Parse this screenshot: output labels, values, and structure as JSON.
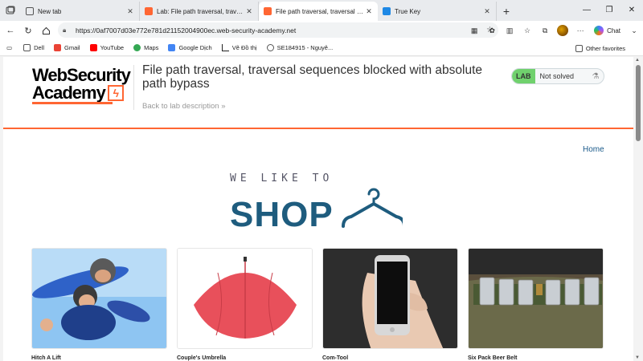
{
  "browser": {
    "tabs": [
      {
        "title": "New tab",
        "active": false
      },
      {
        "title": "Lab: File path traversal, traversal se",
        "active": false
      },
      {
        "title": "File path traversal, traversal seque",
        "active": true
      },
      {
        "title": "True Key",
        "active": false
      }
    ],
    "url": "https://0af7007d03e772e781d21152004900ec.web-security-academy.net",
    "chat_label": "Chat",
    "bookmarks": [
      "Dell",
      "Gmail",
      "YouTube",
      "Maps",
      "Google Dịch",
      "Vẽ Đồ thị",
      "SE184915 - Nguyê..."
    ],
    "other_favorites": "Other favorites"
  },
  "lab": {
    "logo_line1": "WebSecurity",
    "logo_line2": "Academy",
    "title": "File path traversal, traversal sequences blocked with absolute path bypass",
    "back_link": "Back to lab description »",
    "status_badge": "LAB",
    "status_text": "Not solved"
  },
  "shop": {
    "home_link": "Home",
    "banner_top": "WE LIKE TO",
    "banner_main": "SHOP",
    "products": [
      {
        "name": "Hitch A Lift",
        "image": "skydivers"
      },
      {
        "name": "Couple's Umbrella",
        "image": "red-umbrella"
      },
      {
        "name": "Com-Tool",
        "image": "phone-in-hand"
      },
      {
        "name": "Six Pack Beer Belt",
        "image": "beer-belt"
      }
    ]
  },
  "colors": {
    "accent": "#ff6633",
    "shop_blue": "#1e5c7e",
    "lab_green": "#70d16d"
  }
}
